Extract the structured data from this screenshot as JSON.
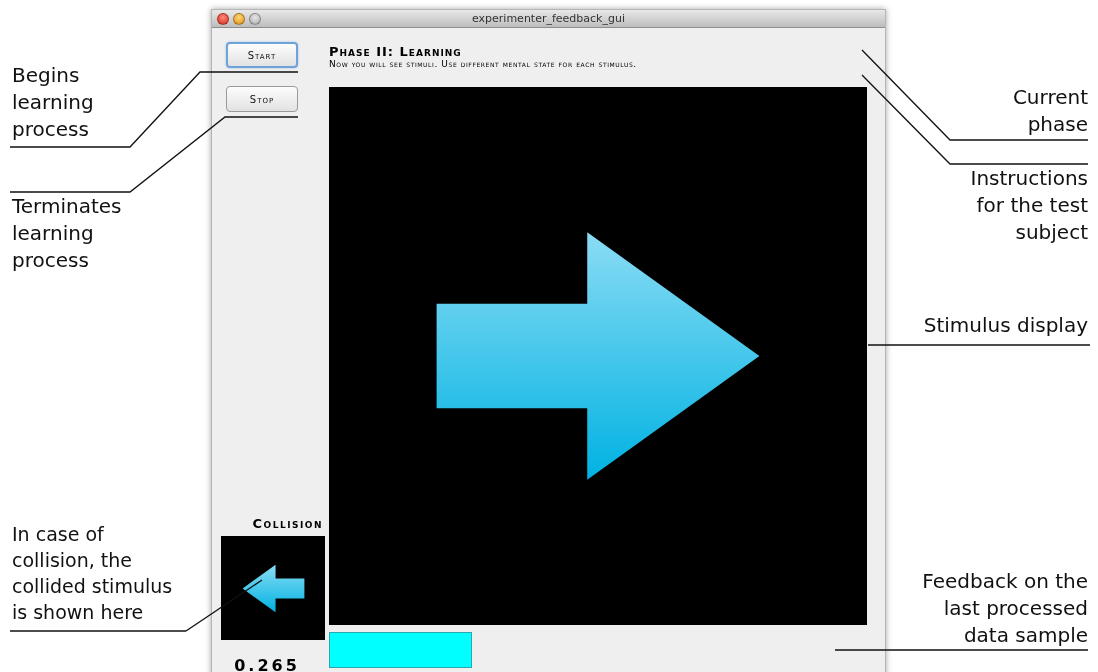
{
  "window": {
    "title": "experimenter_feedback_gui"
  },
  "buttons": [
    {
      "label": "Start",
      "focused": true
    },
    {
      "label": "Stop",
      "focused": false
    }
  ],
  "phase": {
    "title": "Phase II: Learning",
    "instructions": "Now you will see stimuli. Use different mental state for each stimulus."
  },
  "collision": {
    "label": "Collision"
  },
  "feedback": {
    "reading": "0.265"
  },
  "annotations": [
    {
      "text": "Begins\nlearning\nprocess"
    },
    {
      "text": "Terminates\nlearning\nprocess"
    },
    {
      "text": "In case of\ncollision, the\ncollided stimulus\nis shown here"
    },
    {
      "text": "Current\nphase"
    },
    {
      "text": "Instructions\nfor the test\nsubject"
    },
    {
      "text": "Stimulus display"
    },
    {
      "text": "Feedback on the\nlast processed\ndata sample"
    }
  ]
}
